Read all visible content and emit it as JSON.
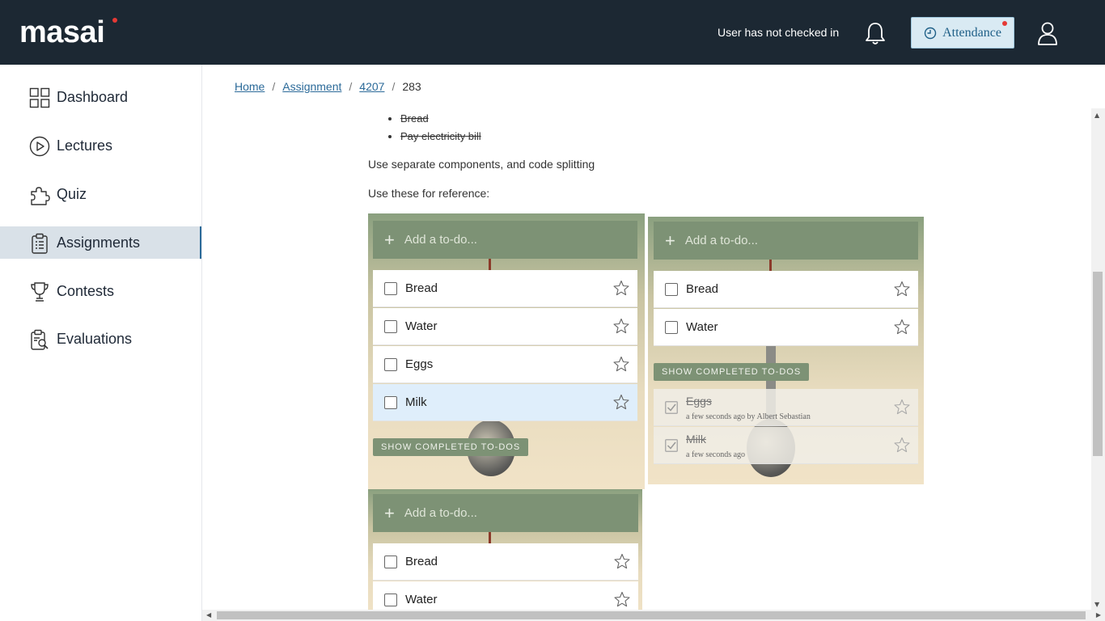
{
  "header": {
    "logo": "masai",
    "checkin_status": "User has not checked in",
    "attendance_label": "Attendance"
  },
  "sidebar": {
    "items": [
      {
        "label": "Dashboard",
        "icon": "grid-icon"
      },
      {
        "label": "Lectures",
        "icon": "play-circle-icon"
      },
      {
        "label": "Quiz",
        "icon": "puzzle-icon"
      },
      {
        "label": "Assignments",
        "icon": "clipboard-icon",
        "active": true
      },
      {
        "label": "Contests",
        "icon": "trophy-icon"
      },
      {
        "label": "Evaluations",
        "icon": "report-search-icon"
      }
    ]
  },
  "breadcrumb": {
    "home": "Home",
    "assignment": "Assignment",
    "id": "4207",
    "current": "283",
    "sep": "/"
  },
  "content": {
    "bullets": [
      "Bread",
      "Pay electricity bill"
    ],
    "para1": "Use separate components, and code splitting",
    "para2": "Use these for reference:"
  },
  "panels": {
    "add_placeholder": "Add a to-do...",
    "show_completed": "SHOW COMPLETED TO-DOS",
    "panel1": {
      "items": [
        "Bread",
        "Water",
        "Eggs",
        "Milk"
      ]
    },
    "panel2": {
      "items": [
        "Bread",
        "Water"
      ],
      "completed": [
        {
          "text": "Eggs",
          "meta": "a few seconds ago by Albert Sebastian"
        },
        {
          "text": "Milk",
          "meta": "a few seconds ago"
        }
      ]
    },
    "panel3": {
      "items": [
        "Bread",
        "Water"
      ]
    }
  },
  "colors": {
    "topbar": "#1c2833",
    "accent": "#2b6a99",
    "todo_header": "#7d9275",
    "selected_row": "#dfeefb"
  }
}
